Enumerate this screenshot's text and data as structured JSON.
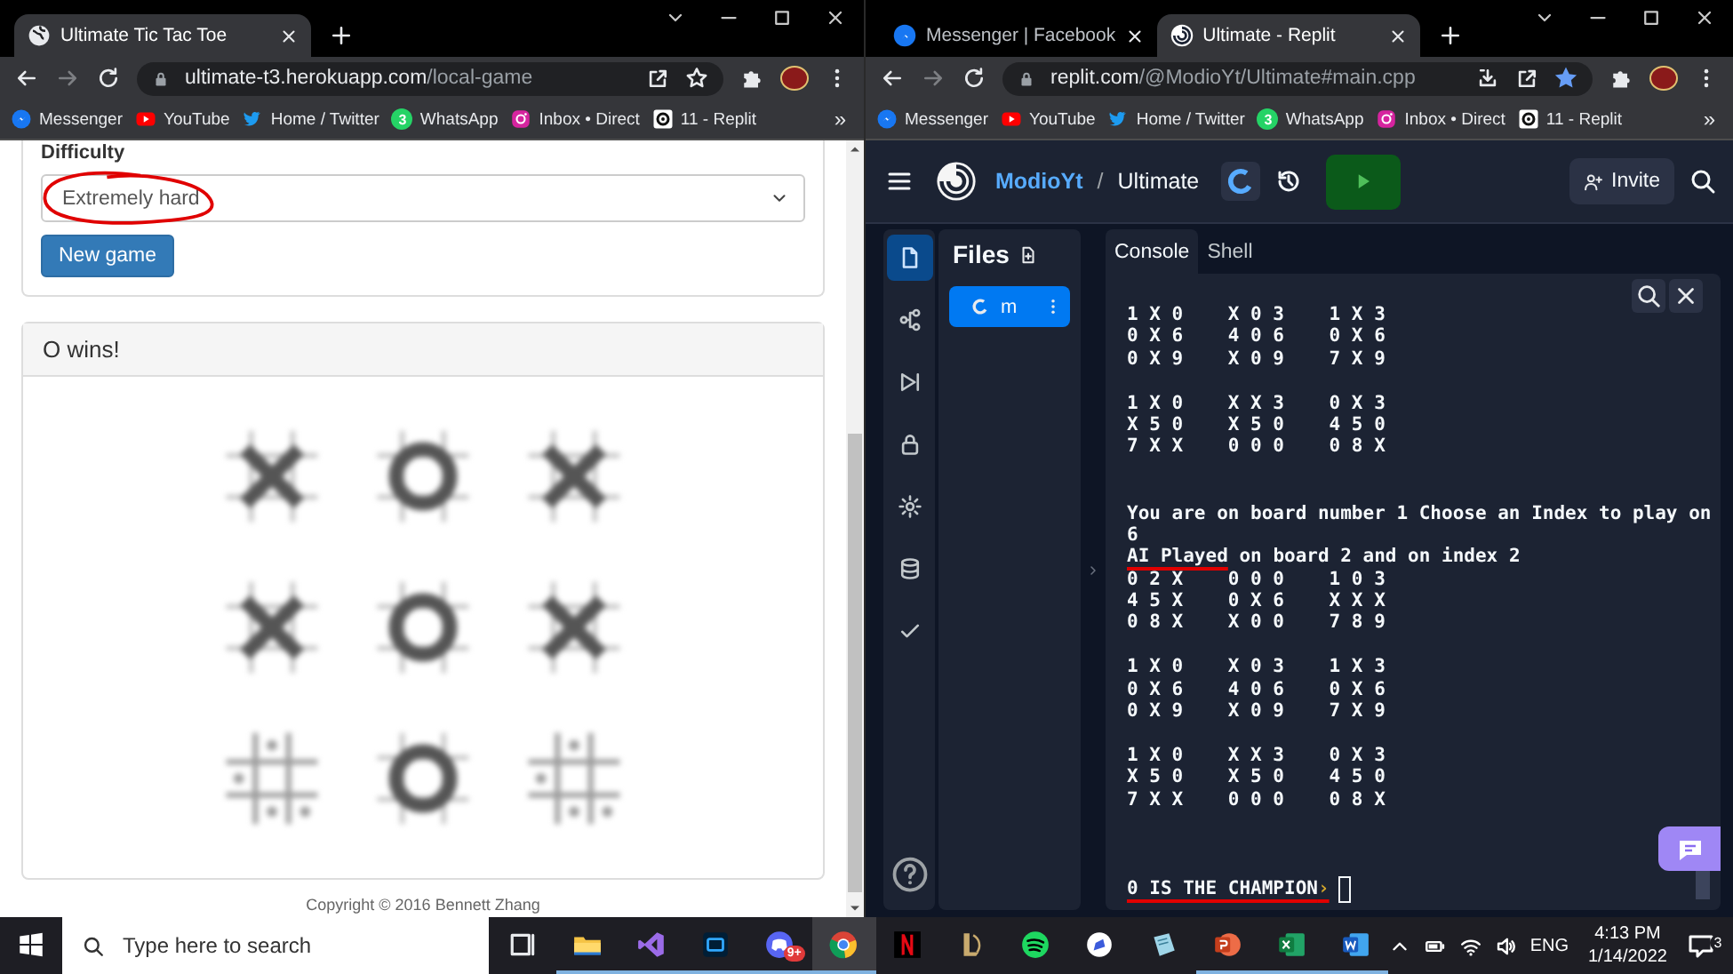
{
  "left_window": {
    "tabs": [
      {
        "title": "Ultimate Tic Tac Toe",
        "kind": "globe",
        "selected": true
      }
    ],
    "address": {
      "host": "ultimate-t3.herokuapp.com",
      "path": "/local-game",
      "bookmarked": false
    },
    "bookmarks": [
      {
        "label": "Messenger",
        "kind": "messenger"
      },
      {
        "label": "YouTube",
        "kind": "youtube"
      },
      {
        "label": "Home / Twitter",
        "kind": "twitter"
      },
      {
        "label": "WhatsApp",
        "kind": "whatsapp",
        "badge": "3"
      },
      {
        "label": "Inbox • Direct",
        "kind": "instagram"
      },
      {
        "label": "11 - Replit",
        "kind": "replit"
      }
    ],
    "bookmarks_more": "»",
    "page": {
      "difficulty": {
        "label": "Difficulty",
        "value": "Extremely hard",
        "circled": true
      },
      "new_game_button": "New game",
      "result_title": "O wins!",
      "boards": [
        {
          "kind": "x"
        },
        {
          "kind": "o"
        },
        {
          "kind": "x"
        },
        {
          "kind": "x"
        },
        {
          "kind": "o"
        },
        {
          "kind": "x"
        },
        {
          "kind": "open"
        },
        {
          "kind": "o"
        },
        {
          "kind": "open"
        }
      ],
      "footer": "Copyright © 2016 Bennett Zhang"
    }
  },
  "right_window": {
    "tabs": [
      {
        "title": "Messenger | Facebook",
        "kind": "facebook",
        "selected": false
      },
      {
        "title": "Ultimate - Replit",
        "kind": "replit",
        "selected": true
      }
    ],
    "address": {
      "host": "replit.com",
      "path": "/@ModioYt/Ultimate#main.cpp",
      "bookmarked": true,
      "install": true
    },
    "bookmarks": [
      {
        "label": "Messenger",
        "kind": "messenger"
      },
      {
        "label": "YouTube",
        "kind": "youtube"
      },
      {
        "label": "Home / Twitter",
        "kind": "twitter"
      },
      {
        "label": "WhatsApp",
        "kind": "whatsapp",
        "badge": "3"
      },
      {
        "label": "Inbox • Direct",
        "kind": "instagram"
      },
      {
        "label": "11 - Replit",
        "kind": "replit"
      }
    ],
    "bookmarks_more": "»",
    "replit": {
      "user": "ModioYt",
      "separator": "/",
      "repl": "Ultimate",
      "invite": "Invite",
      "rail": [
        {
          "kind": "files",
          "selected": true
        },
        {
          "kind": "git",
          "selected": false
        },
        {
          "kind": "debug",
          "selected": false
        },
        {
          "kind": "secrets",
          "selected": false
        },
        {
          "kind": "settings",
          "selected": false
        },
        {
          "kind": "database",
          "selected": false
        },
        {
          "kind": "check",
          "selected": false
        }
      ],
      "files_title": "Files",
      "files": [
        {
          "name": "m",
          "selected": true
        }
      ],
      "console_tabs": [
        {
          "label": "Console",
          "selected": true
        },
        {
          "label": "Shell",
          "selected": false
        }
      ],
      "console_lines": [
        {
          "kind": "text",
          "text": "1 X 0    X 0 3    1 X 3"
        },
        {
          "kind": "text",
          "text": "0 X 6    4 0 6    0 X 6"
        },
        {
          "kind": "text",
          "text": "0 X 9    X 0 9    7 X 9"
        },
        {
          "kind": "blank"
        },
        {
          "kind": "text",
          "text": "1 X 0    X X 3    0 X 3"
        },
        {
          "kind": "text",
          "text": "X 5 0    X 5 0    4 5 0"
        },
        {
          "kind": "text",
          "text": "7 X X    0 0 0    0 8 X"
        },
        {
          "kind": "blank"
        },
        {
          "kind": "blank"
        },
        {
          "kind": "text",
          "text": "You are on board number 1 Choose an Index to play on"
        },
        {
          "kind": "text",
          "text": "6"
        },
        {
          "kind": "segments",
          "segments": [
            {
              "text": "AI Played",
              "underlined": true
            },
            {
              "text": " on board 2 and on index 2",
              "underlined": false
            }
          ]
        },
        {
          "kind": "text",
          "text": "0 2 X    0 0 0    1 0 3"
        },
        {
          "kind": "text",
          "text": "4 5 X    0 X 6    X X X"
        },
        {
          "kind": "text",
          "text": "0 8 X    X 0 0    7 8 9"
        },
        {
          "kind": "blank"
        },
        {
          "kind": "text",
          "text": "1 X 0    X 0 3    1 X 3"
        },
        {
          "kind": "text",
          "text": "0 X 6    4 0 6    0 X 6"
        },
        {
          "kind": "text",
          "text": "0 X 9    X 0 9    7 X 9"
        },
        {
          "kind": "blank"
        },
        {
          "kind": "text",
          "text": "1 X 0    X X 3    0 X 3"
        },
        {
          "kind": "text",
          "text": "X 5 0    X 5 0    4 5 0"
        },
        {
          "kind": "text",
          "text": "7 X X    0 0 0    0 8 X"
        },
        {
          "kind": "blank"
        },
        {
          "kind": "blank"
        },
        {
          "kind": "blank"
        },
        {
          "kind": "input",
          "text": "0 IS THE CHAMPION",
          "prompt": "›",
          "underlined": true
        }
      ]
    }
  },
  "taskbar": {
    "search_placeholder": "Type here to search",
    "apps": [
      {
        "kind": "explorer",
        "running": true,
        "active": false
      },
      {
        "kind": "visual-studio",
        "running": true,
        "active": false
      },
      {
        "kind": "photoshop",
        "running": true,
        "active": false
      },
      {
        "kind": "discord",
        "running": true,
        "active": false,
        "badge": "9+"
      },
      {
        "kind": "chrome",
        "running": true,
        "active": true
      },
      {
        "kind": "netflix",
        "running": false,
        "active": false
      },
      {
        "kind": "league",
        "running": false,
        "active": false
      },
      {
        "kind": "spotify",
        "running": false,
        "active": false
      },
      {
        "kind": "sketch",
        "running": false,
        "active": false
      },
      {
        "kind": "notepad",
        "running": false,
        "active": false
      },
      {
        "kind": "powerpoint",
        "running": true,
        "active": false
      },
      {
        "kind": "excel",
        "running": true,
        "active": false
      },
      {
        "kind": "word",
        "running": true,
        "active": false
      }
    ],
    "language": "ENG",
    "time": "4:13 PM",
    "date": "1/14/2022",
    "notifications": "3"
  }
}
